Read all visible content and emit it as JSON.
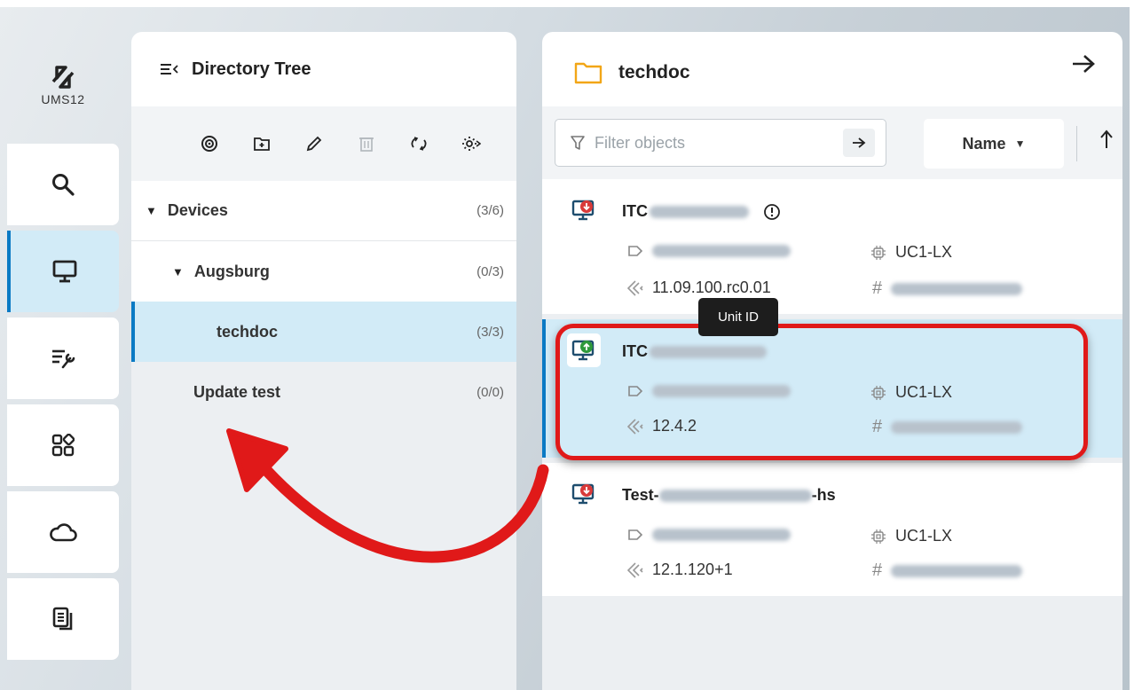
{
  "app": {
    "logo_text": "UMS12"
  },
  "rail": {
    "items": [
      {
        "name": "search",
        "icon": "search-icon"
      },
      {
        "name": "devices",
        "icon": "monitor-icon",
        "active": true
      },
      {
        "name": "configuration",
        "icon": "config-tools-icon"
      },
      {
        "name": "apps",
        "icon": "apps-grid-icon"
      },
      {
        "name": "cloud",
        "icon": "cloud-icon"
      },
      {
        "name": "logs",
        "icon": "document-icon"
      }
    ]
  },
  "tree": {
    "title": "Directory Tree",
    "toolbar_icons": [
      "target-icon",
      "new-folder-icon",
      "edit-icon",
      "delete-icon",
      "refresh-icon",
      "settings-icon"
    ],
    "nodes": [
      {
        "label": "Devices",
        "count": "(3/6)",
        "expanded": true
      },
      {
        "label": "Augsburg",
        "count": "(0/3)",
        "expanded": true
      },
      {
        "label": "techdoc",
        "count": "(3/3)",
        "selected": true
      },
      {
        "label": "Update test",
        "count": "(0/0)"
      }
    ]
  },
  "content": {
    "folder_title": "techdoc",
    "filter_placeholder": "Filter objects",
    "sort_label": "Name",
    "devices": [
      {
        "name_prefix": "ITC",
        "name_suffix": "",
        "unit_id_prefix": "",
        "firmware": "11.09.100.rc0.01",
        "model": "UC1-LX",
        "status": "offline",
        "warning": true
      },
      {
        "name_prefix": "ITC",
        "name_suffix": "",
        "firmware": "12.4.2",
        "model": "UC1-LX",
        "status": "online",
        "selected": true
      },
      {
        "name_prefix": "Test-",
        "name_suffix": "-hs",
        "firmware": "12.1.120+1",
        "model": "UC1-LX",
        "status": "offline"
      }
    ]
  },
  "tooltip": {
    "text": "Unit ID"
  },
  "colors": {
    "accent": "#0a7ac4",
    "selection": "#d2ebf7",
    "annotation": "#e01919",
    "offline": "#d93a3a",
    "online": "#2f9a3c"
  }
}
